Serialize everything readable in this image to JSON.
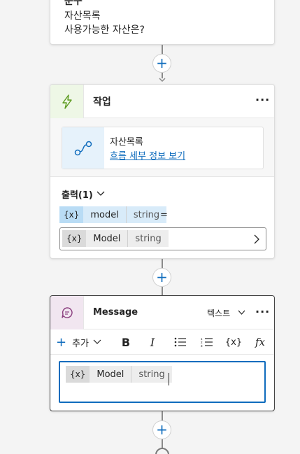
{
  "question_node": {
    "title": "문구",
    "variable_name": "자산목록",
    "question_text": "사용가능한 자산은?"
  },
  "action_node": {
    "title": "작업",
    "flow_name": "자산목록",
    "flow_link": "흐름 세부 정보 보기",
    "outputs_label": "출력(1)",
    "output_var": {
      "icon": "{x}",
      "name": "model",
      "type": "string"
    },
    "equals": "=",
    "assigned_var": {
      "icon": "{x}",
      "name": "Model",
      "type": "string"
    }
  },
  "message_node": {
    "title": "Message",
    "type_label": "텍스트",
    "toolbar": {
      "add_label": "추가",
      "bold": "B",
      "italic": "I",
      "variable": "{x}",
      "formula": "fx"
    },
    "content_var": {
      "icon": "{x}",
      "name": "Model",
      "type": "string"
    }
  },
  "colors": {
    "accent": "#0f6cbd",
    "action_header": "#eef7e6",
    "message_header": "#f1e6f0",
    "variable_chip": "#d8ebf9"
  },
  "icons": [
    "lightning-icon",
    "flow-icon",
    "chat-bubble-icon",
    "add-icon",
    "more-icon",
    "chevron-down-icon",
    "chevron-right-icon"
  ]
}
